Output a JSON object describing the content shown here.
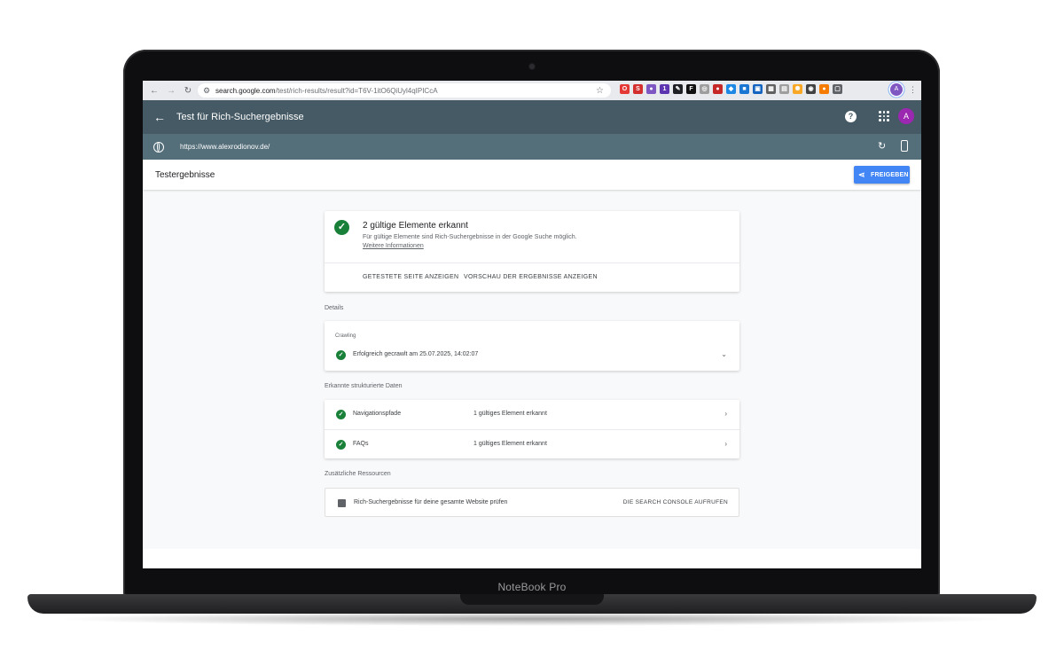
{
  "device": {
    "brand": "NoteBook Pro"
  },
  "browser": {
    "url_host": "search.google.com",
    "url_path": "/test/rich-results/result?id=T6V-1itO6QiUyl4qIPICcA",
    "profile_initial": "A",
    "extensions": [
      {
        "name": "opera-icon",
        "glyph": "O",
        "color": "#e53935"
      },
      {
        "name": "s-icon",
        "glyph": "S",
        "color": "#d32f2f"
      },
      {
        "name": "ext-purple-icon",
        "glyph": "●",
        "color": "#7e57c2"
      },
      {
        "name": "ext-badge-icon",
        "glyph": "1",
        "color": "#5e35b1"
      },
      {
        "name": "pen-icon",
        "glyph": "✎",
        "color": "#202124"
      },
      {
        "name": "ext-dark-icon",
        "glyph": "F",
        "color": "#111111"
      },
      {
        "name": "camera-icon",
        "glyph": "◎",
        "color": "#9e9e9e"
      },
      {
        "name": "ext-red-badge-icon",
        "glyph": "●",
        "color": "#c62828"
      },
      {
        "name": "tag-icon",
        "glyph": "◆",
        "color": "#1e88e5"
      },
      {
        "name": "ext-blue-icon",
        "glyph": "■",
        "color": "#1976d2"
      },
      {
        "name": "ext-blue2-icon",
        "glyph": "▣",
        "color": "#1565c0"
      },
      {
        "name": "grid-icon",
        "glyph": "▦",
        "color": "#616161"
      },
      {
        "name": "table-icon",
        "glyph": "▤",
        "color": "#9e9e9e"
      },
      {
        "name": "gear-icon",
        "glyph": "✺",
        "color": "#f9a825"
      },
      {
        "name": "ext-dark2-icon",
        "glyph": "◉",
        "color": "#424242"
      },
      {
        "name": "ext-orange-icon",
        "glyph": "●",
        "color": "#f57c00"
      },
      {
        "name": "puzzle-icon",
        "glyph": "▢",
        "color": "#5f6368"
      }
    ]
  },
  "app": {
    "title": "Test für Rich-Suchergebnisse",
    "tested_url": "https://www.alexrodionov.de/",
    "avatar_initial": "A",
    "results_label": "Testergebnisse",
    "share_label": "FREIGEBEN"
  },
  "summary": {
    "heading": "2 gültige Elemente erkannt",
    "subtext": "Für gültige Elemente sind Rich-Suchergebnisse in der Google Suche möglich.",
    "more_link": "Weitere Informationen",
    "btn_tested_page": "GETESTETE SEITE ANZEIGEN",
    "btn_preview": "VORSCHAU DER ERGEBNISSE ANZEIGEN"
  },
  "details": {
    "section_label": "Details",
    "caption": "Crawling",
    "status": "Erfolgreich gecrawlt am 25.07.2025, 14:02:07"
  },
  "structured_data": {
    "section_label": "Erkannte strukturierte Daten",
    "rows": [
      {
        "name": "Navigationspfade",
        "count": "1 gültiges Element erkannt"
      },
      {
        "name": "FAQs",
        "count": "1 gültiges Element erkannt"
      }
    ]
  },
  "resources": {
    "section_label": "Zusätzliche Ressourcen",
    "text": "Rich-Suchergebnisse für deine gesamte Website prüfen",
    "cta": "DIE SEARCH CONSOLE AUFRUFEN"
  }
}
